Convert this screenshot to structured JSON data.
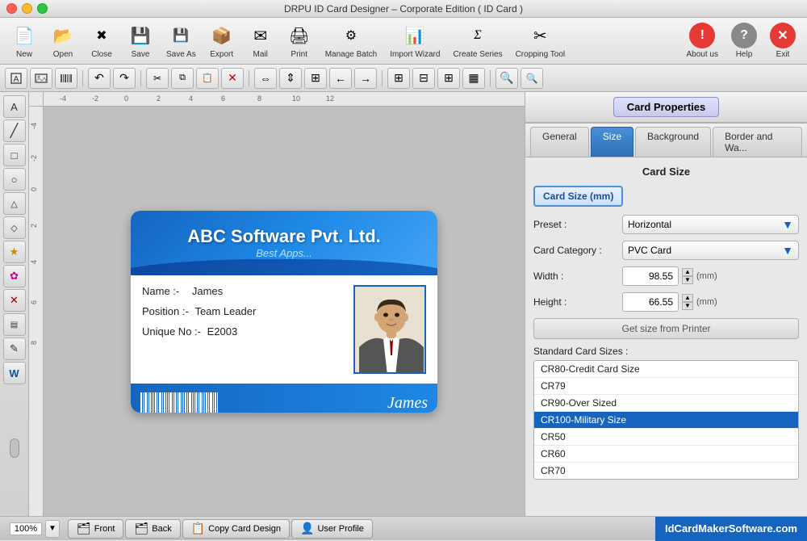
{
  "app": {
    "title": "DRPU ID Card Designer – Corporate Edition ( ID Card )",
    "titlebar_buttons": {
      "close": "×",
      "min": "−",
      "max": "+"
    }
  },
  "toolbar": {
    "items": [
      {
        "id": "new",
        "label": "New",
        "icon": "📄"
      },
      {
        "id": "open",
        "label": "Open",
        "icon": "📂"
      },
      {
        "id": "close",
        "label": "Close",
        "icon": "✖"
      },
      {
        "id": "save",
        "label": "Save",
        "icon": "💾"
      },
      {
        "id": "save-as",
        "label": "Save As",
        "icon": "💾"
      },
      {
        "id": "export",
        "label": "Export",
        "icon": "📦"
      },
      {
        "id": "mail",
        "label": "Mail",
        "icon": "✉"
      },
      {
        "id": "print",
        "label": "Print",
        "icon": "🖨"
      },
      {
        "id": "manage-batch",
        "label": "Manage Batch",
        "icon": "⚙"
      },
      {
        "id": "import-wizard",
        "label": "Import Wizard",
        "icon": "📊"
      },
      {
        "id": "create-series",
        "label": "Create Series",
        "icon": "Σ"
      },
      {
        "id": "cropping-tool",
        "label": "Cropping Tool",
        "icon": "✂"
      }
    ],
    "right_items": [
      {
        "id": "about",
        "label": "About us",
        "icon": "ℹ"
      },
      {
        "id": "help",
        "label": "Help",
        "icon": "?"
      },
      {
        "id": "exit",
        "label": "Exit",
        "icon": "✕"
      }
    ]
  },
  "canvas": {
    "zoom": "100%",
    "id_card": {
      "company": "ABC Software Pvt. Ltd.",
      "subtitle": "Best Apps...",
      "name_label": "Name :-",
      "name_value": "James",
      "position_label": "Position :-",
      "position_value": "Team Leader",
      "unique_label": "Unique No :-",
      "unique_value": "E2003",
      "signature": "James"
    }
  },
  "right_panel": {
    "title": "Card Properties",
    "tabs": [
      {
        "id": "general",
        "label": "General"
      },
      {
        "id": "size",
        "label": "Size",
        "active": true
      },
      {
        "id": "background",
        "label": "Background"
      },
      {
        "id": "border",
        "label": "Border and Wa..."
      }
    ],
    "card_size_section": "Card Size",
    "card_size_box_label": "Card Size (mm)",
    "fields": {
      "preset_label": "Preset :",
      "preset_value": "Horizontal",
      "category_label": "Card Category :",
      "category_value": "PVC Card",
      "width_label": "Width :",
      "width_value": "98.55",
      "width_unit": "(mm)",
      "height_label": "Height :",
      "height_value": "66.55",
      "height_unit": "(mm)"
    },
    "printer_button": "Get size from Printer",
    "standard_sizes_label": "Standard Card Sizes :",
    "sizes": [
      {
        "id": "cr80",
        "label": "CR80-Credit Card Size",
        "selected": false
      },
      {
        "id": "cr79",
        "label": "CR79",
        "selected": false
      },
      {
        "id": "cr90",
        "label": "CR90-Over Sized",
        "selected": false
      },
      {
        "id": "cr100",
        "label": "CR100-Military Size",
        "selected": true
      },
      {
        "id": "cr50",
        "label": "CR50",
        "selected": false
      },
      {
        "id": "cr60",
        "label": "CR60",
        "selected": false
      },
      {
        "id": "cr70",
        "label": "CR70",
        "selected": false
      }
    ]
  },
  "bottom_bar": {
    "buttons": [
      {
        "id": "front",
        "label": "Front",
        "icon": "🗂"
      },
      {
        "id": "back",
        "label": "Back",
        "icon": "🗂"
      },
      {
        "id": "copy",
        "label": "Copy Card Design",
        "icon": "📋"
      },
      {
        "id": "profile",
        "label": "User Profile",
        "icon": "👤"
      }
    ],
    "brand": "IdCardMakerSoftware.com"
  },
  "left_tools": [
    {
      "id": "select",
      "icon": "A"
    },
    {
      "id": "line",
      "icon": "╱"
    },
    {
      "id": "rect",
      "icon": "□"
    },
    {
      "id": "ellipse",
      "icon": "○"
    },
    {
      "id": "triangle",
      "icon": "△"
    },
    {
      "id": "diamond",
      "icon": "◇"
    },
    {
      "id": "star",
      "icon": "★"
    },
    {
      "id": "flower",
      "icon": "✿"
    },
    {
      "id": "cross",
      "icon": "✕"
    },
    {
      "id": "barcode",
      "icon": "▤"
    },
    {
      "id": "pen",
      "icon": "✎"
    },
    {
      "id": "word",
      "icon": "W"
    }
  ]
}
